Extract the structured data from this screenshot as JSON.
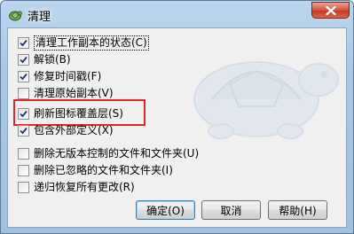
{
  "window": {
    "title": "清理"
  },
  "options": [
    {
      "label": "清理工作副本的状态(C)",
      "checked": true
    },
    {
      "label": "解锁(B)",
      "checked": true
    },
    {
      "label": "修复时间戳(F)",
      "checked": true
    },
    {
      "label": "清理原始副本(V)",
      "checked": false
    },
    {
      "label": "刷新图标覆盖层(S)",
      "checked": true
    },
    {
      "label": "包含外部定义(X)",
      "checked": true
    },
    {
      "label": "删除无版本控制的文件和文件夹(U)",
      "checked": false
    },
    {
      "label": "删除已忽略的文件和文件夹(I)",
      "checked": false
    },
    {
      "label": "递归恢复所有更改(R)",
      "checked": false
    }
  ],
  "buttons": {
    "ok": "确定(O)",
    "cancel": "取消",
    "help": "帮助(H)"
  },
  "colors": {
    "highlight": "#e0262a",
    "close_button": "#c23b21"
  }
}
